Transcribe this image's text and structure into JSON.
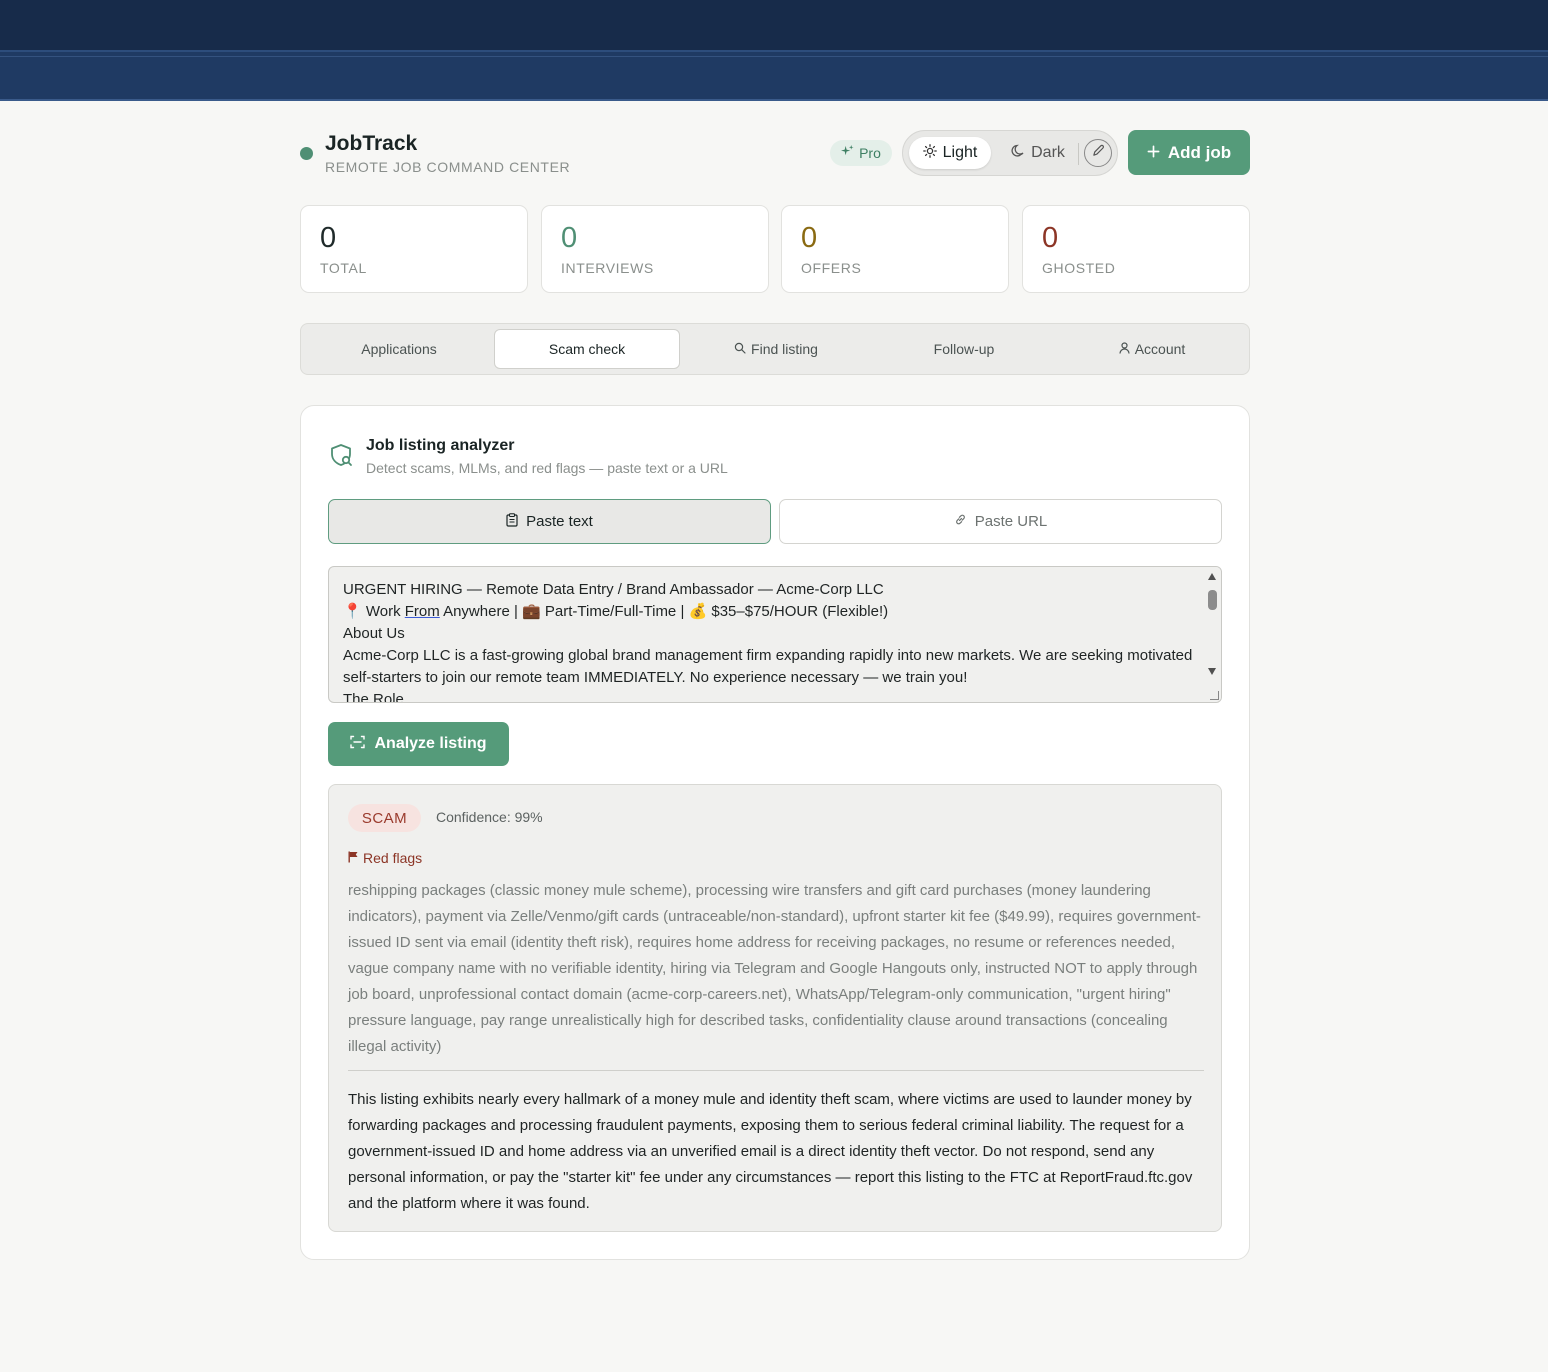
{
  "app": {
    "name": "JobTrack",
    "tagline": "REMOTE JOB COMMAND CENTER",
    "pro_label": "Pro",
    "theme": {
      "light_label": "Light",
      "dark_label": "Dark"
    },
    "add_job_label": "Add job"
  },
  "stats": [
    {
      "value": "0",
      "label": "TOTAL",
      "color": "#1a2424"
    },
    {
      "value": "0",
      "label": "INTERVIEWS",
      "color": "#4f8f74"
    },
    {
      "value": "0",
      "label": "OFFERS",
      "color": "#8a6a12"
    },
    {
      "value": "0",
      "label": "GHOSTED",
      "color": "#8c3526"
    }
  ],
  "tabs": [
    {
      "label": "Applications",
      "icon": ""
    },
    {
      "label": "Scam check",
      "icon": "",
      "active": true
    },
    {
      "label": "Find listing",
      "icon": "search-icon"
    },
    {
      "label": "Follow-up",
      "icon": ""
    },
    {
      "label": "Account",
      "icon": "user-icon"
    }
  ],
  "analyzer": {
    "title": "Job listing analyzer",
    "subtitle": "Detect scams, MLMs, and red flags — paste text or a URL",
    "mode_text_label": "Paste text",
    "mode_url_label": "Paste URL",
    "listing_lines": {
      "l1": "URGENT HIRING — Remote Data Entry / Brand Ambassador — Acme-Corp LLC",
      "l2_pin": "📍",
      "l2_a": " Work ",
      "l2_from": "From",
      "l2_b": " Anywhere | ",
      "l2_bag": "💼",
      "l2_c": " Part-Time/Full-Time | ",
      "l2_money": "💰",
      "l2_d": " $35–$75/HOUR (Flexible!)",
      "l3": "About Us",
      "l4": "Acme-Corp LLC is a fast-growing global brand management firm expanding rapidly into new markets. We are seeking motivated self-starters to join our remote team IMMEDIATELY. No experience necessary — we train you!",
      "l5": "The Role"
    },
    "analyze_label": "Analyze listing"
  },
  "result": {
    "verdict": "SCAM",
    "confidence": "Confidence: 99%",
    "red_flags_title": "Red flags",
    "red_flags_text": "reshipping packages (classic money mule scheme), processing wire transfers and gift card purchases (money laundering indicators), payment via Zelle/Venmo/gift cards (untraceable/non-standard), upfront starter kit fee ($49.99), requires government-issued ID sent via email (identity theft risk), requires home address for receiving packages, no resume or references needed, vague company name with no verifiable identity, hiring via Telegram and Google Hangouts only, instructed NOT to apply through job board, unprofessional contact domain (acme-corp-careers.net), WhatsApp/Telegram-only communication, \"urgent hiring\" pressure language, pay range unrealistically high for described tasks, confidentiality clause around transactions (concealing illegal activity)",
    "summary": "This listing exhibits nearly every hallmark of a money mule and identity theft scam, where victims are used to launder money by forwarding packages and processing fraudulent payments, exposing them to serious federal criminal liability. The request for a government-issued ID and home address via an unverified email is a direct identity theft vector. Do not respond, send any personal information, or pay the \"starter kit\" fee under any circumstances — report this listing to the FTC at ReportFraud.ftc.gov and the platform where it was found."
  }
}
